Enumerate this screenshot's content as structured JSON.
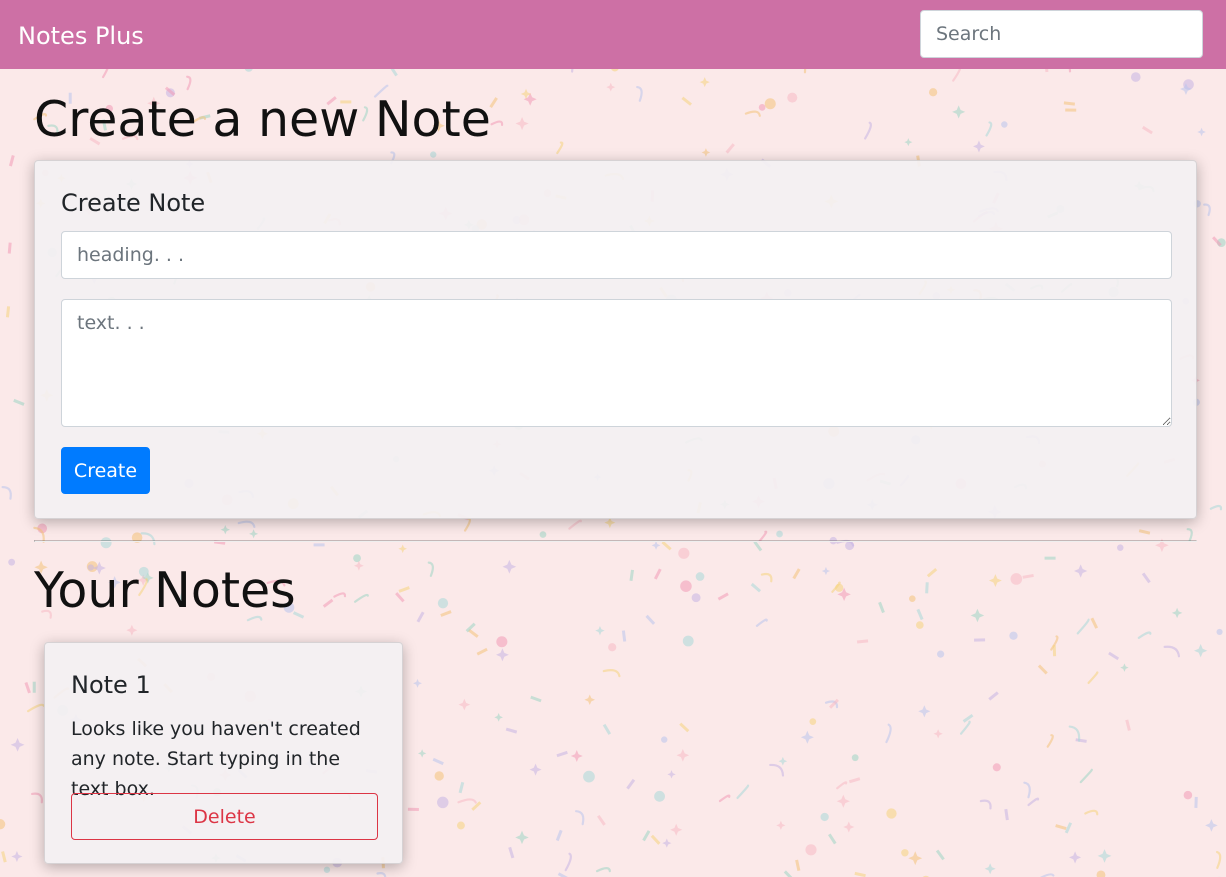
{
  "navbar": {
    "brand": "Notes Plus",
    "search_placeholder": "Search"
  },
  "create_section": {
    "heading": "Create a new Note",
    "card_title": "Create Note",
    "heading_input_placeholder": "heading. . .",
    "text_input_placeholder": "text. . .",
    "create_button_label": "Create"
  },
  "notes_section": {
    "heading": "Your Notes",
    "notes": [
      {
        "title": "Note 1",
        "text": "Looks like you haven't created any note. Start typing in the text box.",
        "delete_label": "Delete"
      }
    ]
  },
  "colors": {
    "navbar": "#cd70a5",
    "background": "#fbe9e9",
    "primary_button": "#007bff",
    "danger": "#dc3545"
  }
}
